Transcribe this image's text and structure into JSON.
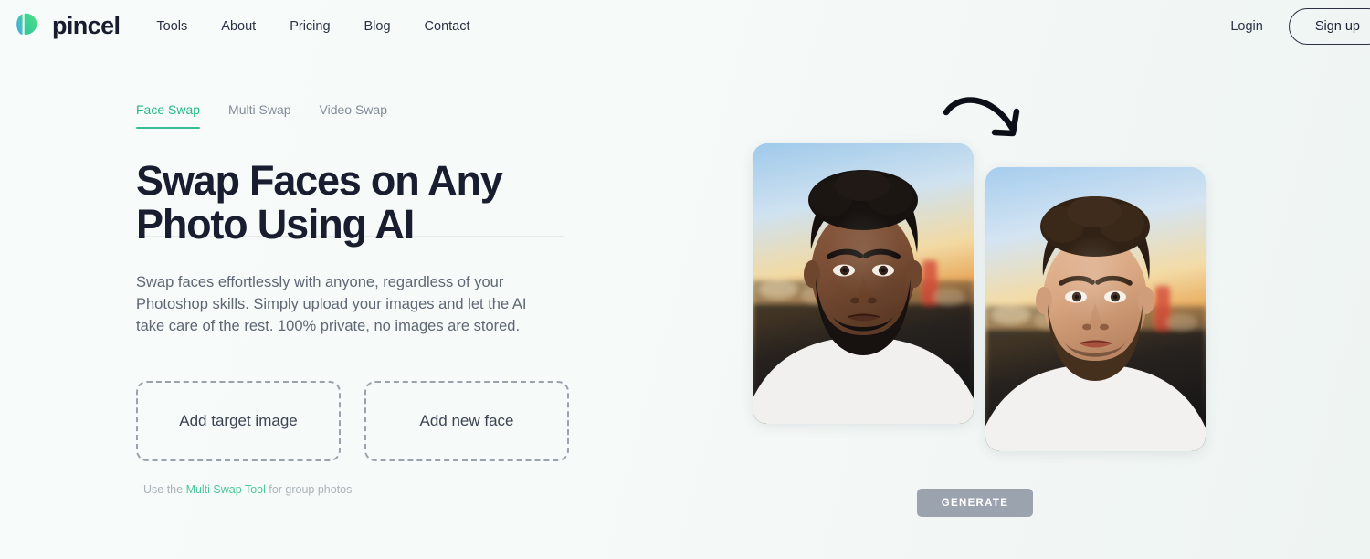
{
  "brand": {
    "name": "pincel",
    "logo_icon": "pincel-leaf-logo-icon"
  },
  "nav": {
    "items": [
      {
        "label": "Tools"
      },
      {
        "label": "About"
      },
      {
        "label": "Pricing"
      },
      {
        "label": "Blog"
      },
      {
        "label": "Contact"
      }
    ],
    "login_label": "Login",
    "signup_label": "Sign up"
  },
  "tool": {
    "tabs": [
      {
        "label": "Face Swap",
        "active": true
      },
      {
        "label": "Multi Swap",
        "active": false
      },
      {
        "label": "Video Swap",
        "active": false
      }
    ],
    "headline": "Swap Faces on Any Photo Using AI",
    "description": "Swap faces effortlessly with anyone, regardless of your Photoshop skills. Simply upload your images and let the AI take care of the rest. 100% private, no images are stored.",
    "upload_target_label": "Add target image",
    "upload_face_label": "Add new face",
    "hint_prefix": "Use the ",
    "hint_link": "Multi Swap Tool",
    "hint_suffix": " for group photos",
    "generate_label": "GENERATE"
  },
  "preview": {
    "arrow_icon": "curved-arrow-icon",
    "source_photo_alt": "Portrait of man with curly hair and full beard in white t-shirt at sunset",
    "result_photo_alt": "Same portrait with a swapped face at sunset"
  },
  "colors": {
    "accent_green": "#36bf97",
    "link_green": "#4cc79b",
    "heading_navy": "#181e30",
    "body_gray": "#5e6774",
    "muted_gray": "#aab2b9",
    "disabled_button": "#9ba3af",
    "page_bg_left": "#f7fbf9",
    "page_bg_right": "#eef4f2"
  }
}
